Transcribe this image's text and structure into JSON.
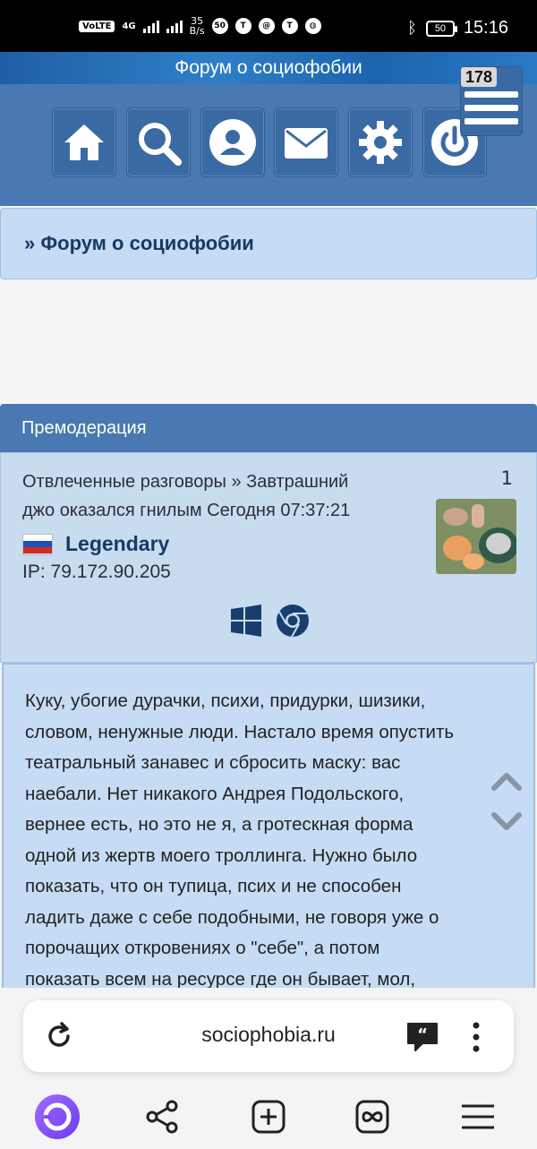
{
  "status_bar": {
    "network_badge": "VoLTE",
    "network_gen": "4G",
    "speed_value": "35",
    "speed_unit": "B/s",
    "notif_count": "50",
    "battery": "50",
    "time": "15:16"
  },
  "forum": {
    "banner_title": "Форум о социофобии",
    "notification_count": "178",
    "nav_icons": [
      "home-icon",
      "search-icon",
      "profile-icon",
      "mail-icon",
      "settings-icon",
      "power-icon"
    ],
    "breadcrumb": "» Форум о социофобии"
  },
  "premoderation": {
    "header": "Премодерация",
    "post": {
      "topic_line1": "Отвлеченные разговоры » Завтрашний",
      "topic_line2": "джо оказался гнилым Сегодня 07:37:21",
      "number": "1",
      "username": "Legendary",
      "ip": "IP: 79.172.90.205",
      "os_icon": "windows-icon",
      "browser_icon": "chrome-icon",
      "body_lines": [
        "Куку, убогие дурачки, психи, придурки, шизики,",
        "словом, ненужные люди. Настало время опустить",
        "театральный занавес и сбросить маску: вас",
        "наебали. Нет никакого Андрея Подольского,",
        "вернее есть, но это не я, а гротескная форма",
        "одной из жертв моего троллинга. Нужно было",
        "показать, что он тупица, псих и не способен",
        "ладить даже с себе подобными, не говоря уже о",
        "порочащих откровениях о \"себе\", а потом",
        "показать всем на ресурсе где он бывает, мол,"
      ]
    }
  },
  "browser": {
    "url": "sociophobia.ru",
    "bottom_icons": [
      "alice-icon",
      "share-icon",
      "new-tab-icon",
      "tabs-icon",
      "menu-icon"
    ]
  },
  "colors": {
    "nav_blue": "#4a78b3",
    "panel_light": "#c5dcf4",
    "title_navy": "#163a66"
  }
}
